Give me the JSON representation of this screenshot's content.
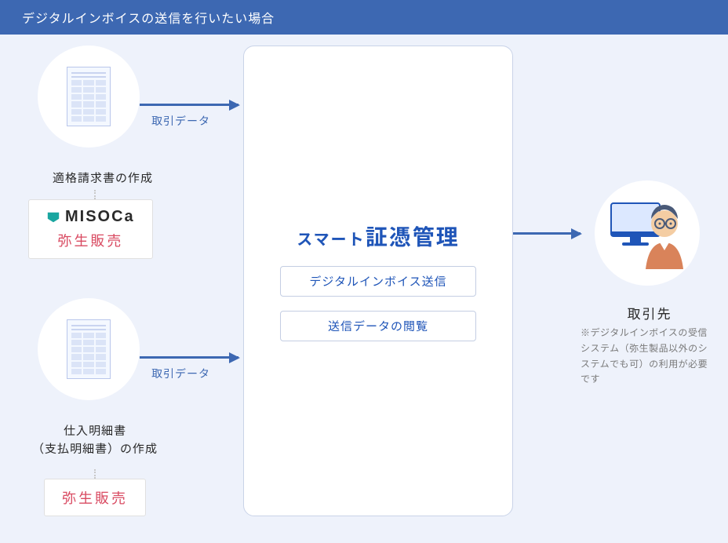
{
  "title": "デジタルインボイスの送信を行いたい場合",
  "left": {
    "top_label": "適格請求書の作成",
    "bot_label": "仕入明細書\n（支払明細書）の作成",
    "misoca": "MISOCa",
    "yayoi": "弥生販売",
    "arrow_label": "取引データ"
  },
  "center": {
    "title_small": "スマート",
    "title_large": "証憑管理",
    "button1": "デジタルインボイス送信",
    "button2": "送信データの閲覧"
  },
  "right": {
    "label": "取引先",
    "note": "※デジタルインボイスの受信システム（弥生製品以外のシステムでも可）の利用が必要です"
  }
}
